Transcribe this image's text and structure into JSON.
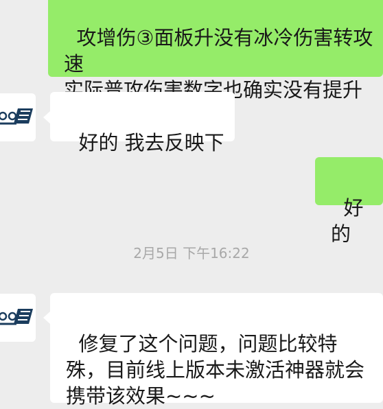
{
  "chat": {
    "messages": [
      {
        "sender": "me",
        "text": "攻增伤③面板升没有冰冷伤害转攻速\n实际普攻伤害数字也确实没有提升"
      },
      {
        "sender": "other",
        "text": "好的 我去反映下"
      },
      {
        "sender": "me",
        "text": "好的"
      },
      {
        "sender": "other",
        "text": "修复了这个问题，问题比较特殊，目前线上版本未激活神器就会携带该效果~~~"
      }
    ],
    "timestamp": "2月5日 下午16:22"
  },
  "colors": {
    "background": "#ededed",
    "bubble_me": "#95ec69",
    "bubble_other": "#ffffff",
    "timestamp_text": "#a8a8a8"
  },
  "icons": {
    "avatar": "cartoon-logo-avatar"
  }
}
